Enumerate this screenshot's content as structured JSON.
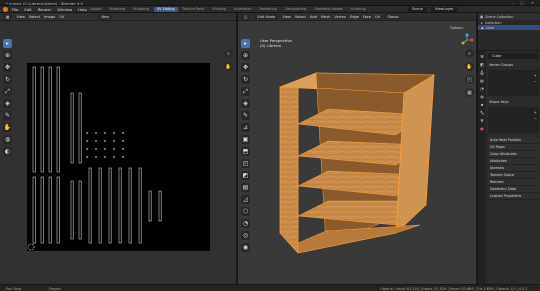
{
  "window": {
    "title": "* inzana (C:\\Libreria.blend) - Blender 4.0",
    "controls": [
      "–",
      "□",
      "✕"
    ]
  },
  "menubar": {
    "items": [
      "File",
      "Edit",
      "Render",
      "Window",
      "Help"
    ],
    "workspaces": [
      "Layout",
      "Modeling",
      "Sculpting",
      "UV Editing",
      "Texture Paint",
      "Shading",
      "Animation",
      "Rendering",
      "Compositing",
      "Geometry Nodes",
      "Scripting"
    ],
    "active_workspace": "UV Editing",
    "scene": "Scene",
    "view_layer": "ViewLayer"
  },
  "uv_editor": {
    "header": [
      "View",
      "Select",
      "Image",
      "UV"
    ],
    "image_button": "New",
    "tools": [
      "cursor",
      "select",
      "move",
      "rotate",
      "scale",
      "transform",
      "annotate",
      "grab",
      "relax",
      "pinch"
    ]
  },
  "viewport": {
    "mode": "Edit Mode",
    "header": [
      "View",
      "Select",
      "Add",
      "Mesh",
      "Vertex",
      "Edge",
      "Face",
      "UV"
    ],
    "orientation": "Global",
    "options_label": "Options",
    "info_line1": "User Perspective",
    "info_line2": "(0) Libreria",
    "colors": {
      "wood": "#c88a48",
      "wood_light": "#d9a066",
      "edge": "#ffa033",
      "background": "#393939"
    }
  },
  "outliner": {
    "header": "Scene Collection",
    "rows": [
      {
        "label": "Collection",
        "selected": false
      },
      {
        "label": "Libre",
        "selected": true
      }
    ]
  },
  "properties": {
    "object_name": "Cube",
    "panels": [
      {
        "label": "Vertex Groups",
        "box": true
      },
      {
        "label": "Shape Keys",
        "box": true
      }
    ],
    "subpanels": [
      "Auto Next Position",
      "UV Maps",
      "Color Attributes",
      "Attributes",
      "Normals",
      "Texture Space",
      "Remesh",
      "Geometry Data",
      "Custom Properties"
    ]
  },
  "statusbar": {
    "left": [
      "Pan View",
      "Region"
    ],
    "right": "Libreria | Verts 0/1,216 | Edges 0/1,826 | Faces 0/2,684 | Tris 3,856 | Objects 1/1 | 4.0.1"
  }
}
